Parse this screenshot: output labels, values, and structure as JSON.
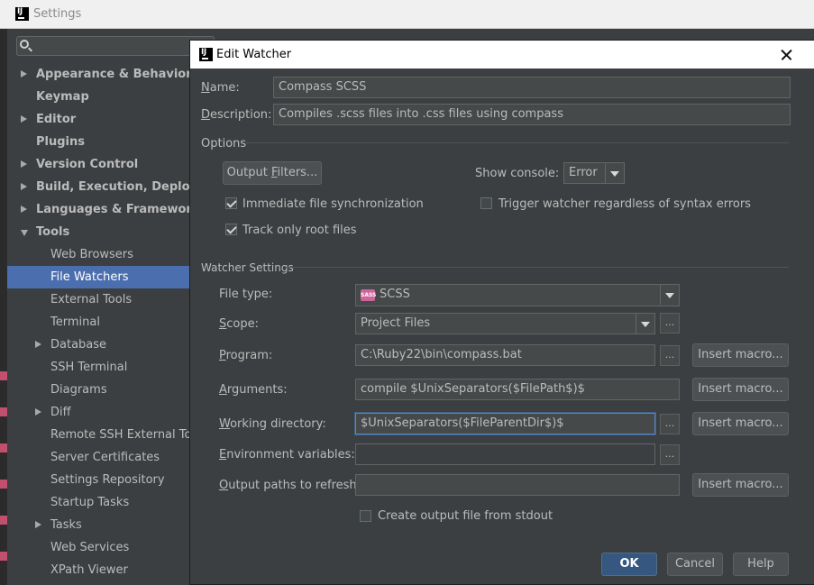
{
  "settings": {
    "title": "Settings",
    "search": {
      "value": "",
      "placeholder": ""
    },
    "tree": [
      {
        "label": "Appearance & Behavior",
        "bold": true,
        "arrow": "right",
        "indent": 0,
        "selected": false
      },
      {
        "label": "Keymap",
        "bold": true,
        "arrow": "",
        "indent": 0,
        "selected": false
      },
      {
        "label": "Editor",
        "bold": true,
        "arrow": "right",
        "indent": 0,
        "selected": false
      },
      {
        "label": "Plugins",
        "bold": true,
        "arrow": "",
        "indent": 0,
        "selected": false
      },
      {
        "label": "Version Control",
        "bold": true,
        "arrow": "right",
        "indent": 0,
        "selected": false
      },
      {
        "label": "Build, Execution, Deployment",
        "bold": true,
        "arrow": "right",
        "indent": 0,
        "selected": false
      },
      {
        "label": "Languages & Frameworks",
        "bold": true,
        "arrow": "right",
        "indent": 0,
        "selected": false
      },
      {
        "label": "Tools",
        "bold": true,
        "arrow": "down",
        "indent": 0,
        "selected": false
      },
      {
        "label": "Web Browsers",
        "bold": false,
        "arrow": "",
        "indent": 1,
        "selected": false
      },
      {
        "label": "File Watchers",
        "bold": false,
        "arrow": "",
        "indent": 1,
        "selected": true
      },
      {
        "label": "External Tools",
        "bold": false,
        "arrow": "",
        "indent": 1,
        "selected": false
      },
      {
        "label": "Terminal",
        "bold": false,
        "arrow": "",
        "indent": 1,
        "selected": false
      },
      {
        "label": "Database",
        "bold": false,
        "arrow": "right",
        "indent": 1,
        "selected": false
      },
      {
        "label": "SSH Terminal",
        "bold": false,
        "arrow": "",
        "indent": 1,
        "selected": false
      },
      {
        "label": "Diagrams",
        "bold": false,
        "arrow": "",
        "indent": 1,
        "selected": false
      },
      {
        "label": "Diff",
        "bold": false,
        "arrow": "right",
        "indent": 1,
        "selected": false
      },
      {
        "label": "Remote SSH External Tools",
        "bold": false,
        "arrow": "",
        "indent": 1,
        "selected": false
      },
      {
        "label": "Server Certificates",
        "bold": false,
        "arrow": "",
        "indent": 1,
        "selected": false
      },
      {
        "label": "Settings Repository",
        "bold": false,
        "arrow": "",
        "indent": 1,
        "selected": false
      },
      {
        "label": "Startup Tasks",
        "bold": false,
        "arrow": "",
        "indent": 1,
        "selected": false
      },
      {
        "label": "Tasks",
        "bold": false,
        "arrow": "right",
        "indent": 1,
        "selected": false
      },
      {
        "label": "Web Services",
        "bold": false,
        "arrow": "",
        "indent": 1,
        "selected": false
      },
      {
        "label": "XPath Viewer",
        "bold": false,
        "arrow": "",
        "indent": 1,
        "selected": false
      }
    ]
  },
  "dialog": {
    "title": "Edit Watcher",
    "name": {
      "label_u": "N",
      "label_rest": "ame:",
      "value": "Compass SCSS"
    },
    "description": {
      "label_u": "D",
      "label_rest": "escription:",
      "value": "Compiles .scss files into .css files using compass"
    },
    "options": {
      "header": "Options",
      "output_filters_pre": "Output ",
      "output_filters_u": "F",
      "output_filters_post": "ilters...",
      "show_console_label": "Show console:",
      "show_console_value": "Error",
      "immediate_sync": {
        "label": "Immediate file synchronization",
        "checked": true
      },
      "track_root": {
        "label": "Track only root files",
        "checked": true
      },
      "trigger_regardless": {
        "label": "Trigger watcher regardless of syntax errors",
        "checked": false
      }
    },
    "watcher": {
      "header": "Watcher Settings",
      "file_type": {
        "label": "File type:",
        "value": "SCSS",
        "icon_text": "SASS"
      },
      "scope": {
        "label_u": "S",
        "label_rest": "cope:",
        "value": "Project Files"
      },
      "program": {
        "label_u": "P",
        "label_rest": "rogram:",
        "value": "C:\\Ruby22\\bin\\compass.bat"
      },
      "arguments": {
        "label_u": "A",
        "label_rest": "rguments:",
        "value": "compile $UnixSeparators($FilePath$)$"
      },
      "working_dir": {
        "label_u": "W",
        "label_rest": "orking directory:",
        "value": "$UnixSeparators($FileParentDir$)$"
      },
      "env_vars": {
        "label_u": "E",
        "label_rest": "nvironment variables:",
        "value": ""
      },
      "output_paths": {
        "label_u": "O",
        "label_rest": "utput paths to refresh:",
        "value": ""
      },
      "create_output": {
        "label": "Create output file from stdout",
        "checked": false
      },
      "insert_macro": "Insert macro...",
      "browse": "..."
    },
    "buttons": {
      "ok": "OK",
      "cancel": "Cancel",
      "help": "Help"
    }
  },
  "colors": {
    "selection": "#4b6eaf",
    "ok_button": "#365880",
    "background": "#3c3f41"
  }
}
